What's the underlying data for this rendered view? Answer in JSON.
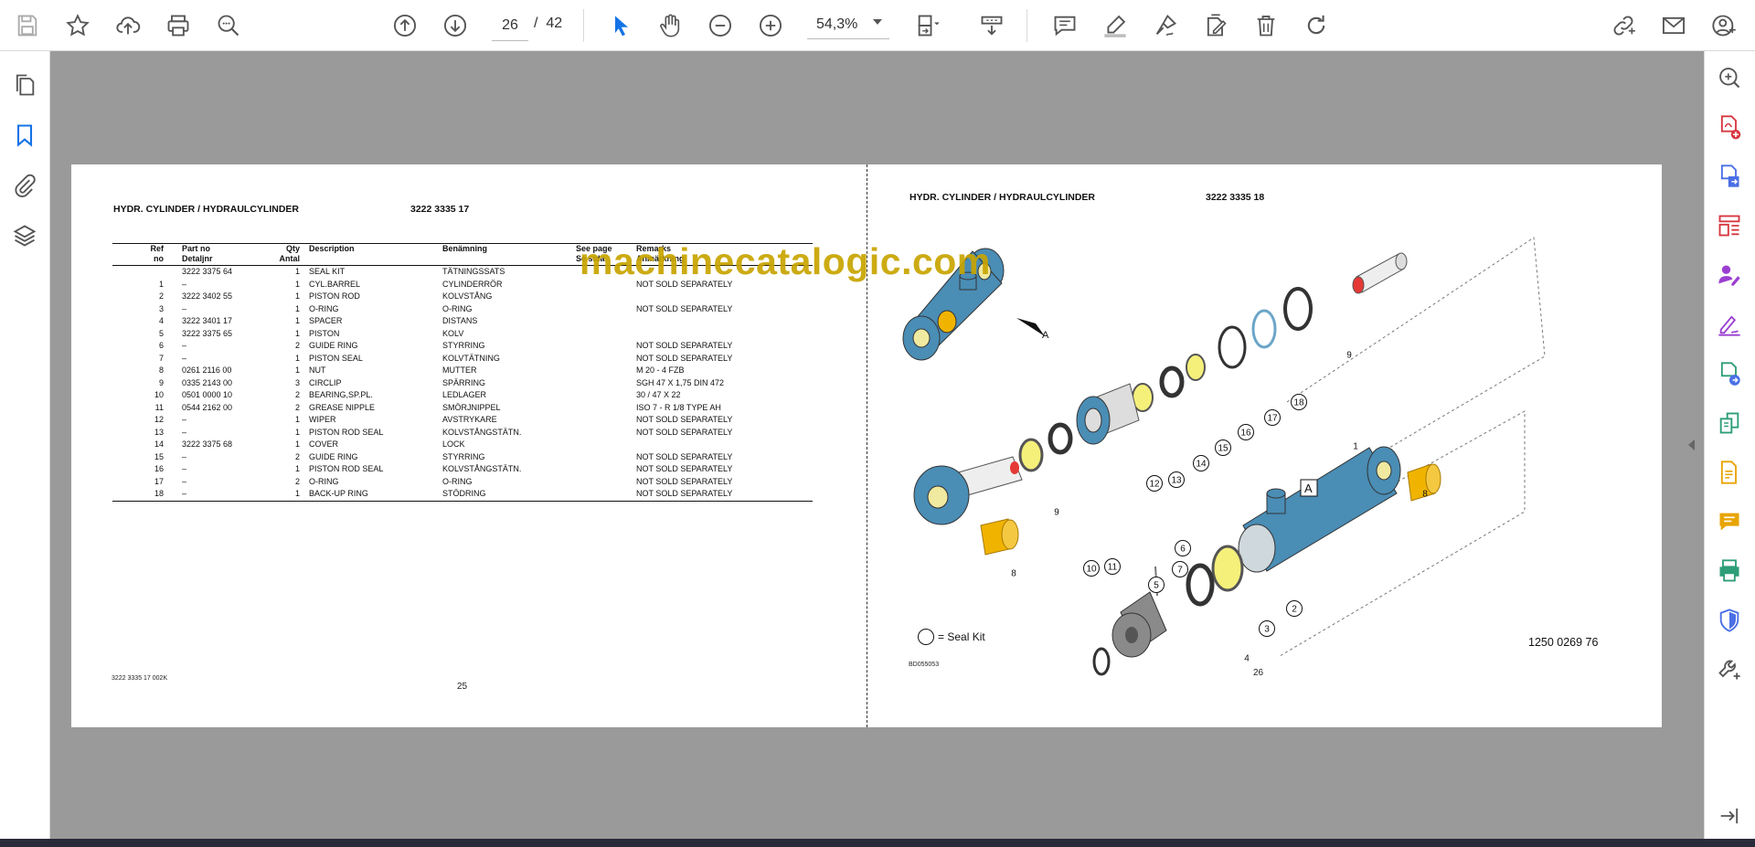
{
  "toolbar": {
    "page_current": "26",
    "page_separator": "/",
    "page_total": "42",
    "zoom": "54,3%"
  },
  "document": {
    "left_page": {
      "title": "HYDR. CYLINDER / HYDRAULCYLINDER",
      "part_number": "3222 3335 17",
      "footer_code": "3222 3335 17  002K",
      "page_number": "25",
      "columns": {
        "ref": [
          "Ref",
          "no"
        ],
        "part": [
          "Part no",
          "Detaljnr"
        ],
        "qty": [
          "Qty",
          "Antal"
        ],
        "desc": [
          "Description",
          ""
        ],
        "ben": [
          "Benämning",
          ""
        ],
        "see": [
          "See page",
          "Se sida"
        ],
        "rem": [
          "Remarks",
          "Anmärkning"
        ]
      },
      "rows": [
        {
          "ref": "",
          "part": "3222 3375 64",
          "qty": "1",
          "desc": "SEAL KIT",
          "ben": "TÄTNINGSSATS",
          "see": "",
          "rem": ""
        },
        {
          "ref": "1",
          "part": "–",
          "qty": "1",
          "desc": "CYL.BARREL",
          "ben": "CYLINDERRÖR",
          "see": "",
          "rem": "NOT SOLD SEPARATELY"
        },
        {
          "ref": "2",
          "part": "3222 3402 55",
          "qty": "1",
          "desc": "PISTON ROD",
          "ben": "KOLVSTÅNG",
          "see": "",
          "rem": ""
        },
        {
          "ref": "3",
          "part": "–",
          "qty": "1",
          "desc": "O-RING",
          "ben": "O-RING",
          "see": "",
          "rem": "NOT SOLD SEPARATELY"
        },
        {
          "ref": "4",
          "part": "3222 3401 17",
          "qty": "1",
          "desc": "SPACER",
          "ben": "DISTANS",
          "see": "",
          "rem": ""
        },
        {
          "ref": "5",
          "part": "3222 3375 65",
          "qty": "1",
          "desc": "PISTON",
          "ben": "KOLV",
          "see": "",
          "rem": ""
        },
        {
          "ref": "6",
          "part": "–",
          "qty": "2",
          "desc": "GUIDE RING",
          "ben": "STYRRING",
          "see": "",
          "rem": "NOT SOLD SEPARATELY"
        },
        {
          "ref": "7",
          "part": "–",
          "qty": "1",
          "desc": "PISTON SEAL",
          "ben": "KOLVTÄTNING",
          "see": "",
          "rem": "NOT SOLD SEPARATELY"
        },
        {
          "ref": "8",
          "part": "0261 2116 00",
          "qty": "1",
          "desc": "NUT",
          "ben": "MUTTER",
          "see": "",
          "rem": "M 20 - 4 FZB"
        },
        {
          "ref": "9",
          "part": "0335 2143 00",
          "qty": "3",
          "desc": "CIRCLIP",
          "ben": "SPÄRRING",
          "see": "",
          "rem": "SGH  47 X 1,75 DIN 472"
        },
        {
          "ref": "10",
          "part": "0501 0000 10",
          "qty": "2",
          "desc": "BEARING,SP.PL.",
          "ben": "LEDLAGER",
          "see": "",
          "rem": "30 / 47 X 22"
        },
        {
          "ref": "11",
          "part": "0544 2162 00",
          "qty": "2",
          "desc": "GREASE NIPPLE",
          "ben": "SMÖRJNIPPEL",
          "see": "",
          "rem": "ISO 7 - R 1/8 TYPE AH"
        },
        {
          "ref": "12",
          "part": "–",
          "qty": "1",
          "desc": "WIPER",
          "ben": "AVSTRYKARE",
          "see": "",
          "rem": "NOT SOLD SEPARATELY"
        },
        {
          "ref": "13",
          "part": "–",
          "qty": "1",
          "desc": "PISTON ROD SEAL",
          "ben": "KOLVSTÅNGSTÄTN.",
          "see": "",
          "rem": "NOT SOLD SEPARATELY"
        },
        {
          "ref": "14",
          "part": "3222 3375 68",
          "qty": "1",
          "desc": "COVER",
          "ben": "LOCK",
          "see": "",
          "rem": ""
        },
        {
          "ref": "15",
          "part": "–",
          "qty": "2",
          "desc": "GUIDE RING",
          "ben": "STYRRING",
          "see": "",
          "rem": "NOT SOLD SEPARATELY"
        },
        {
          "ref": "16",
          "part": "–",
          "qty": "1",
          "desc": "PISTON ROD SEAL",
          "ben": "KOLVSTÅNGSTÄTN.",
          "see": "",
          "rem": "NOT SOLD SEPARATELY"
        },
        {
          "ref": "17",
          "part": "–",
          "qty": "2",
          "desc": "O-RING",
          "ben": "O-RING",
          "see": "",
          "rem": "NOT SOLD SEPARATELY"
        },
        {
          "ref": "18",
          "part": "–",
          "qty": "1",
          "desc": "BACK-UP RING",
          "ben": "STÖDRING",
          "see": "",
          "rem": "NOT SOLD SEPARATELY"
        }
      ]
    },
    "right_page": {
      "title": "HYDR. CYLINDER / HYDRAULCYLINDER",
      "part_number": "3222 3335 18",
      "footer_code": "BD055053",
      "page_number": "26",
      "seal_kit_legend": "= Seal Kit",
      "drawing_number": "1250 0269 76",
      "view_labels": [
        "A",
        "A"
      ],
      "callouts": [
        "1",
        "2",
        "3",
        "4",
        "5",
        "6",
        "7",
        "8",
        "8",
        "9",
        "9",
        "10",
        "11",
        "12",
        "13",
        "14",
        "15",
        "16",
        "17",
        "18"
      ]
    },
    "watermark": "machinecatalogic.com"
  },
  "colors": {
    "accent_blue": "#1473e6",
    "cylinder_blue": "#4a8db5",
    "bearing_gold": "#f0b400",
    "seal_yellow": "#f5f07a",
    "right_rail_red": "#d7373f",
    "right_rail_purple": "#9b3fd1",
    "right_rail_green": "#2d9d78",
    "right_rail_yellow": "#e8a400"
  },
  "icons": {
    "toolbar_left": [
      "save-icon",
      "star-icon",
      "upload-icon",
      "print-icon",
      "zoom-search-icon"
    ],
    "toolbar_nav": [
      "page-up-icon",
      "page-down-icon"
    ],
    "toolbar_tools": [
      "select-arrow-icon",
      "hand-icon",
      "zoom-out-icon",
      "zoom-in-icon",
      "fit-page-icon",
      "scroll-mode-icon"
    ],
    "toolbar_annot": [
      "comment-icon",
      "highlight-icon",
      "sign-icon",
      "edit-icon",
      "delete-icon",
      "rotate-icon"
    ],
    "toolbar_right": [
      "share-link-icon",
      "email-icon",
      "account-icon"
    ],
    "left_rail": [
      "pages-icon",
      "bookmark-icon",
      "attachment-icon",
      "layers-icon"
    ],
    "right_rail": [
      "find-icon",
      "create-pdf-icon",
      "export-pdf-icon",
      "organize-icon",
      "request-sign-icon",
      "fill-sign-icon",
      "edit-pdf-icon",
      "compress-icon",
      "combine-icon",
      "comment-tool-icon",
      "print-production-icon",
      "protect-icon",
      "more-tools-icon",
      "collapse-panel-icon"
    ]
  }
}
